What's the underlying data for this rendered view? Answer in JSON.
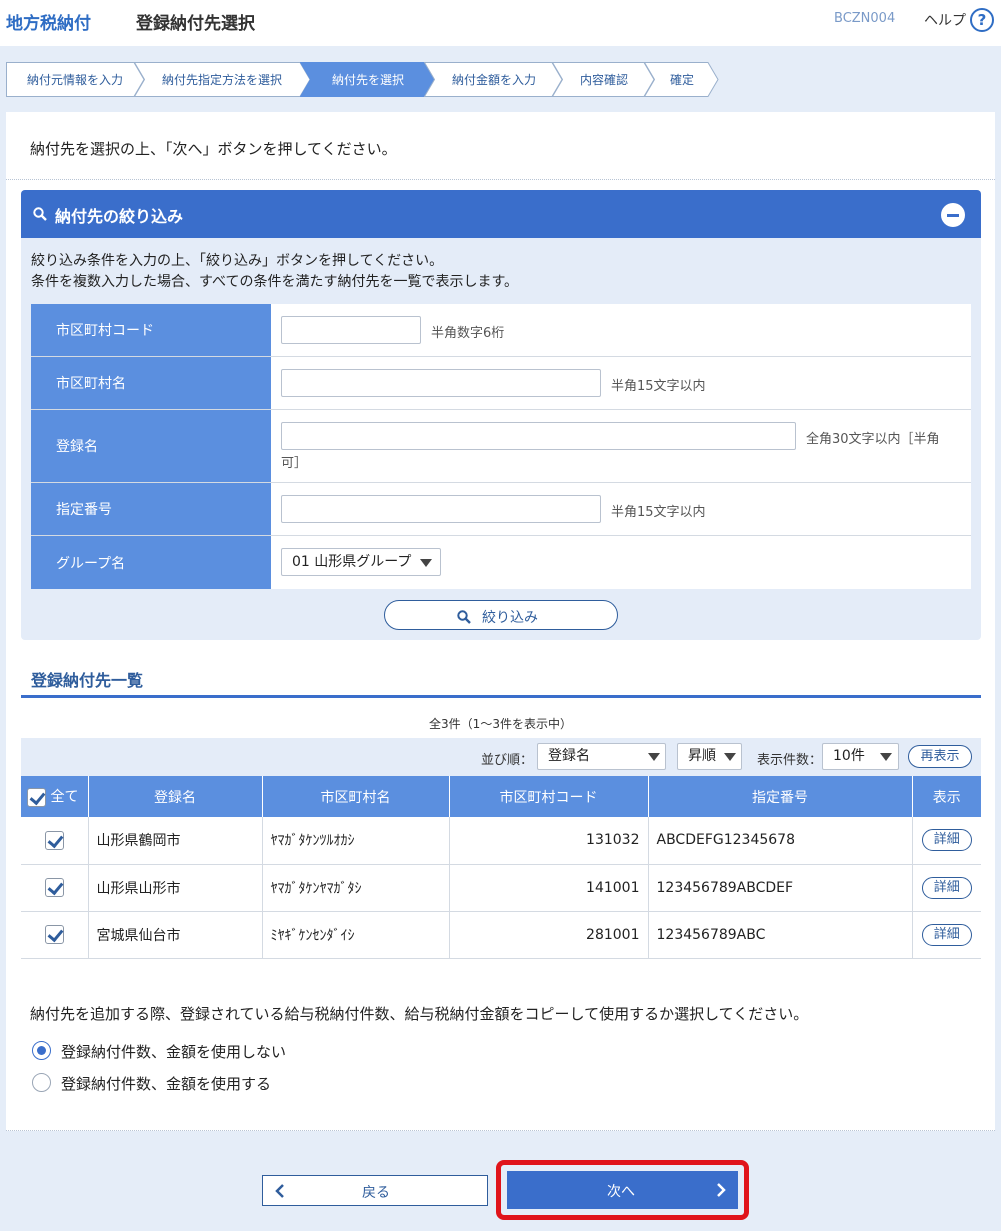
{
  "header": {
    "app_title": "地方税納付",
    "page_title": "登録納付先選択",
    "screen_id": "BCZN004",
    "help_label": "ヘルプ",
    "help_icon_glyph": "?"
  },
  "steps": [
    {
      "label": "納付元情報を入力",
      "active": false
    },
    {
      "label": "納付先指定方法を選択",
      "active": false
    },
    {
      "label": "納付先を選択",
      "active": true
    },
    {
      "label": "納付金額を入力",
      "active": false
    },
    {
      "label": "内容確認",
      "active": false
    },
    {
      "label": "確定",
      "active": false
    }
  ],
  "intro_text": "納付先を選択の上、「次へ」ボタンを押してください。",
  "filter": {
    "title": "納付先の絞り込み",
    "desc_line1": "絞り込み条件を入力の上、「絞り込み」ボタンを押してください。",
    "desc_line2": "条件を複数入力した場合、すべての条件を満たす納付先を一覧で表示します。",
    "fields": {
      "municipality_code": {
        "label": "市区町村コード",
        "value": "",
        "hint": "半角数字6桁"
      },
      "municipality_name": {
        "label": "市区町村名",
        "value": "",
        "hint": "半角15文字以内"
      },
      "registered_name": {
        "label": "登録名",
        "value": "",
        "hint_line1": "全角30文字以内［半角",
        "hint_line2": "可］"
      },
      "designation_no": {
        "label": "指定番号",
        "value": "",
        "hint": "半角15文字以内"
      },
      "group_name": {
        "label": "グループ名",
        "value": "01 山形県グループ"
      }
    },
    "button_label": "絞り込み"
  },
  "list": {
    "title": "登録納付先一覧",
    "count_text": "全3件（1～3件を表示中）",
    "sort_label": "並び順：",
    "sort_value": "登録名",
    "order_value": "昇順",
    "per_page_label": "表示件数：",
    "per_page_value": "10件",
    "refresh_label": "再表示",
    "columns": {
      "all": "全て",
      "name": "登録名",
      "municipality": "市区町村名",
      "code": "市区町村コード",
      "designation": "指定番号",
      "display": "表示"
    },
    "rows": [
      {
        "name": "山形県鶴岡市",
        "kana": "ﾔﾏｶﾞﾀｹﾝﾂﾙｵｶｼ",
        "code": "131032",
        "designation": "ABCDEFG12345678",
        "detail": "詳細",
        "checked": true
      },
      {
        "name": "山形県山形市",
        "kana": "ﾔﾏｶﾞﾀｹﾝﾔﾏｶﾞﾀｼ",
        "code": "141001",
        "designation": "123456789ABCDEF",
        "detail": "詳細",
        "checked": true
      },
      {
        "name": "宮城県仙台市",
        "kana": "ﾐﾔｷﾞｹﾝｾﾝﾀﾞｲｼ",
        "code": "281001",
        "designation": "123456789ABC",
        "detail": "詳細",
        "checked": true
      }
    ]
  },
  "copy_option": {
    "question": "納付先を追加する際、登録されている給与税納付件数、給与税納付金額をコピーして使用するか選択してください。",
    "options": [
      {
        "label": "登録納付件数、金額を使用しない",
        "selected": true
      },
      {
        "label": "登録納付件数、金額を使用する",
        "selected": false
      }
    ]
  },
  "footer": {
    "back_label": "戻る",
    "next_label": "次へ"
  },
  "colors": {
    "brand": "#2f6dc4",
    "header_bar": "#3a6ecb",
    "label_cell": "#5b8fdf",
    "highlight": "#e0141b"
  }
}
